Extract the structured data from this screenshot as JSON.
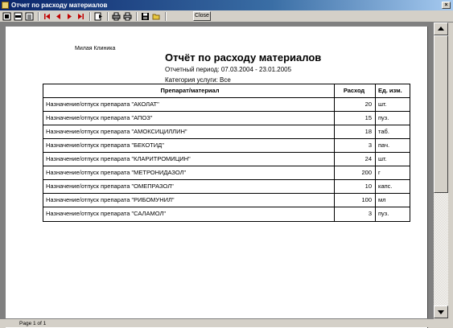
{
  "window": {
    "title": "Отчет по расходу материалов",
    "close_glyph": "×"
  },
  "toolbar": {
    "close_label": "Close",
    "buttons": [
      "fit-page-icon",
      "fit-width-icon",
      "zoom-100-icon",
      "first-page-icon",
      "previous-page-icon",
      "next-page-icon",
      "last-page-icon",
      "goto-page-icon",
      "printer-setup-icon",
      "print-icon",
      "save-icon",
      "open-icon"
    ]
  },
  "report": {
    "organization": "Милая Клиника",
    "title": "Отчёт по расходу материалов",
    "period": "Отчетный период: 07.03.2004 - 23.01.2005",
    "category": "Категория услуги: Все",
    "columns": [
      "Препарат/материал",
      "Расход",
      "Ед. изм."
    ],
    "rows": [
      [
        "Назначение/отпуск препарата \"АКОЛАТ\"",
        "20",
        "шт."
      ],
      [
        "Назначение/отпуск препарата \"АПОЗ\"",
        "15",
        "пуз."
      ],
      [
        "Назначение/отпуск препарата \"АМОКСИЦИЛЛИН\"",
        "18",
        "таб."
      ],
      [
        "Назначение/отпуск препарата \"БЕКОТИД\"",
        "3",
        "пач."
      ],
      [
        "Назначение/отпуск препарата \"КЛАРИТРОМИЦИН\"",
        "24",
        "шт."
      ],
      [
        "Назначение/отпуск препарата \"МЕТРОНИДАЗОЛ\"",
        "200",
        "г"
      ],
      [
        "Назначение/отпуск препарата \"ОМЕПРАЗОЛ\"",
        "10",
        "капс."
      ],
      [
        "Назначение/отпуск препарата \"РИБОМУНИЛ\"",
        "100",
        "мл"
      ],
      [
        "Назначение/отпуск препарата \"САЛАМОЛ\"",
        "3",
        "пуз."
      ]
    ]
  },
  "status": {
    "page": "Page 1 of 1"
  }
}
